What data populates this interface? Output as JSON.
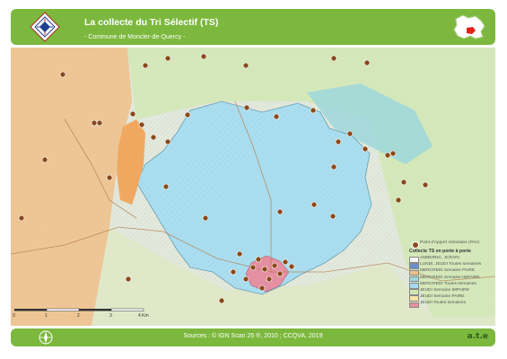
{
  "header": {
    "title": "La collecte du Tri Sélectif (TS)",
    "subtitle": "- Commune de Moncler-de-Quercy -",
    "colors": {
      "band": "#7cb83d",
      "text": "#ffffff"
    }
  },
  "locator": {
    "icon": "department-locator-icon",
    "highlight": "#e2231a"
  },
  "legend": {
    "point_label": "Point d'Apport Volontaire (PAV)",
    "collection_heading": "Collecte TS en porte à porte",
    "items": [
      {
        "label": "AMBERNC, JCRARI",
        "color": "#f3f3f3"
      },
      {
        "label": "LUNDI, JEUDI Toutes semaines",
        "color": "#6d8fc9"
      },
      {
        "label": "MERCREDI Semaine PAIRE",
        "color": "#f0c08a"
      },
      {
        "label": "MERCREDI Semaine IMPAIRE",
        "color": "#9ed7dc"
      },
      {
        "label": "MERCREDI Toutes semaines",
        "color": "#a7d9ee"
      },
      {
        "label": "JEUDI Semaine IMPAIRE",
        "color": "#cfe7b2"
      },
      {
        "label": "JEUDI Semaine PAIRE",
        "color": "#f6e3a6"
      },
      {
        "label": "JEUDI Toutes semaines",
        "color": "#e58fa2"
      }
    ]
  },
  "scale": {
    "labels": [
      "0",
      "1",
      "2",
      "3",
      "4 Km"
    ]
  },
  "footer": {
    "sources": "Sources : © IGN Scan 25 ®, 2010 ; CCQVA, 2019",
    "brand": "a.t.e"
  },
  "map_layers": {
    "zones": [
      {
        "name": "zone-mercredi-toutes",
        "color": "#a7dcee"
      },
      {
        "name": "zone-mercredi-paire",
        "color": "#f0c08a"
      },
      {
        "name": "zone-mercredi-impaire",
        "color": "#9ed7dc"
      },
      {
        "name": "zone-jeudi-impaire",
        "color": "#cfe7b2"
      },
      {
        "name": "zone-jeudi-toutes",
        "color": "#e58fa2"
      }
    ],
    "pav_point_color": "#8a4a1c"
  }
}
